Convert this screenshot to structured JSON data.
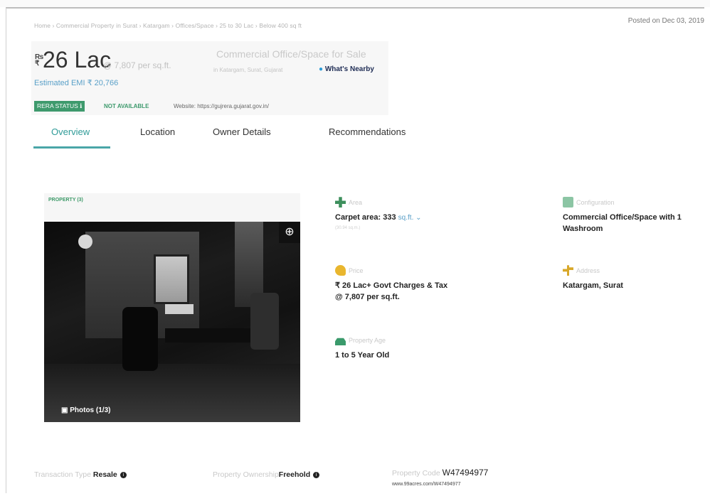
{
  "page": {
    "posted": "Posted on Dec 03, 2019",
    "breadcrumb": "Home › Commercial Property in Surat › Katargam › Offices/Space › 25 to 30 Lac › Below 400 sq ft"
  },
  "price": {
    "currency_symbol": "₹",
    "amount": "26 Lac",
    "per_sqft": "@ 7,807 per sq.ft.",
    "emi_label": "Estimated EMI ₹ 20,766"
  },
  "property": {
    "title": "Commercial Office/Space for Sale",
    "location": "in Katargam, Surat, Gujarat",
    "whats_nearby": "What's Nearby"
  },
  "rera": {
    "badge": "RERA STATUS ℹ",
    "status": "NOT AVAILABLE",
    "website": "Website: https://gujrera.gujarat.gov.in/"
  },
  "tabs": [
    {
      "label": "Overview",
      "active": true
    },
    {
      "label": "Location",
      "active": false
    },
    {
      "label": "Owner Details",
      "active": false
    },
    {
      "label": "Recommendations",
      "active": false
    }
  ],
  "photos": {
    "title": "PROPERTY (3)",
    "button": "Photos (1/3)",
    "zoom_icon": "zoom-in-icon"
  },
  "details": {
    "area": {
      "label": "Area",
      "value": "Carpet area: 333",
      "unit": "sq.ft. ⌄",
      "sub": "(30.94 sq.m.)",
      "icon": "area-icon"
    },
    "configuration": {
      "label": "Configuration",
      "value": "Commercial Office/Space with 1 Washroom",
      "icon": "configuration-icon"
    },
    "price": {
      "label": "Price",
      "value": "₹ 26 Lac+ Govt Charges & Tax",
      "value2": "@ 7,807 per sq.ft.",
      "icon": "price-tag-icon"
    },
    "address": {
      "label": "Address",
      "value": "Katargam, Surat",
      "icon": "address-icon"
    },
    "age": {
      "label": "Property Age",
      "value": "1 to 5 Year Old",
      "icon": "building-icon"
    }
  },
  "footer": {
    "transaction_label": "Transaction Type",
    "transaction_value": "Resale",
    "ownership_label": "Property Ownership",
    "ownership_value": "Freehold",
    "code_label": "Property Code",
    "code_value": "W47494977",
    "code_url": "www.99acres.com/W47494977"
  },
  "colors": {
    "accent": "#2f9b98",
    "rera_green": "#3e9a6d",
    "link_blue": "#5aa0c8"
  }
}
